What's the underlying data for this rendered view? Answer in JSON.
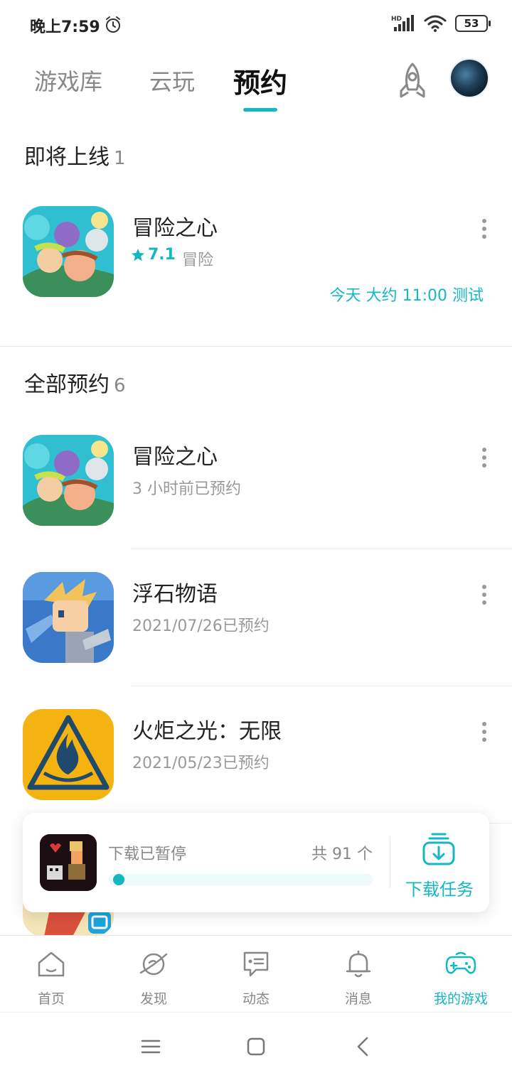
{
  "status_bar": {
    "time": "晚上7:59",
    "network": "HD",
    "battery": "53"
  },
  "top_tabs": [
    {
      "label": "游戏库"
    },
    {
      "label": "云玩"
    },
    {
      "label": "预约"
    }
  ],
  "upcoming": {
    "title": "即将上线",
    "count": "1",
    "games": [
      {
        "name": "冒险之心",
        "rating": "7.1",
        "genre": "冒险",
        "schedule": "今天 大约 11:00 测试"
      }
    ]
  },
  "all_reservations": {
    "title": "全部预约",
    "count": "6",
    "games": [
      {
        "name": "冒险之心",
        "reserved": "3 小时前已预约"
      },
      {
        "name": "浮石物语",
        "reserved": "2021/07/26已预约"
      },
      {
        "name": "火炬之光：无限",
        "reserved": "2021/05/23已预约"
      }
    ]
  },
  "download": {
    "status": "下载已暂停",
    "total": "共 91 个",
    "progress": 0.02,
    "task_label": "下载任务"
  },
  "bottom_nav": [
    {
      "label": "首页",
      "icon": "home-icon"
    },
    {
      "label": "发现",
      "icon": "planet-icon"
    },
    {
      "label": "动态",
      "icon": "message-bubble-icon"
    },
    {
      "label": "消息",
      "icon": "bell-icon"
    },
    {
      "label": "我的游戏",
      "icon": "gamepad-icon"
    }
  ],
  "colors": {
    "accent": "#15b7c3",
    "text": "#222222",
    "muted": "#999999"
  }
}
